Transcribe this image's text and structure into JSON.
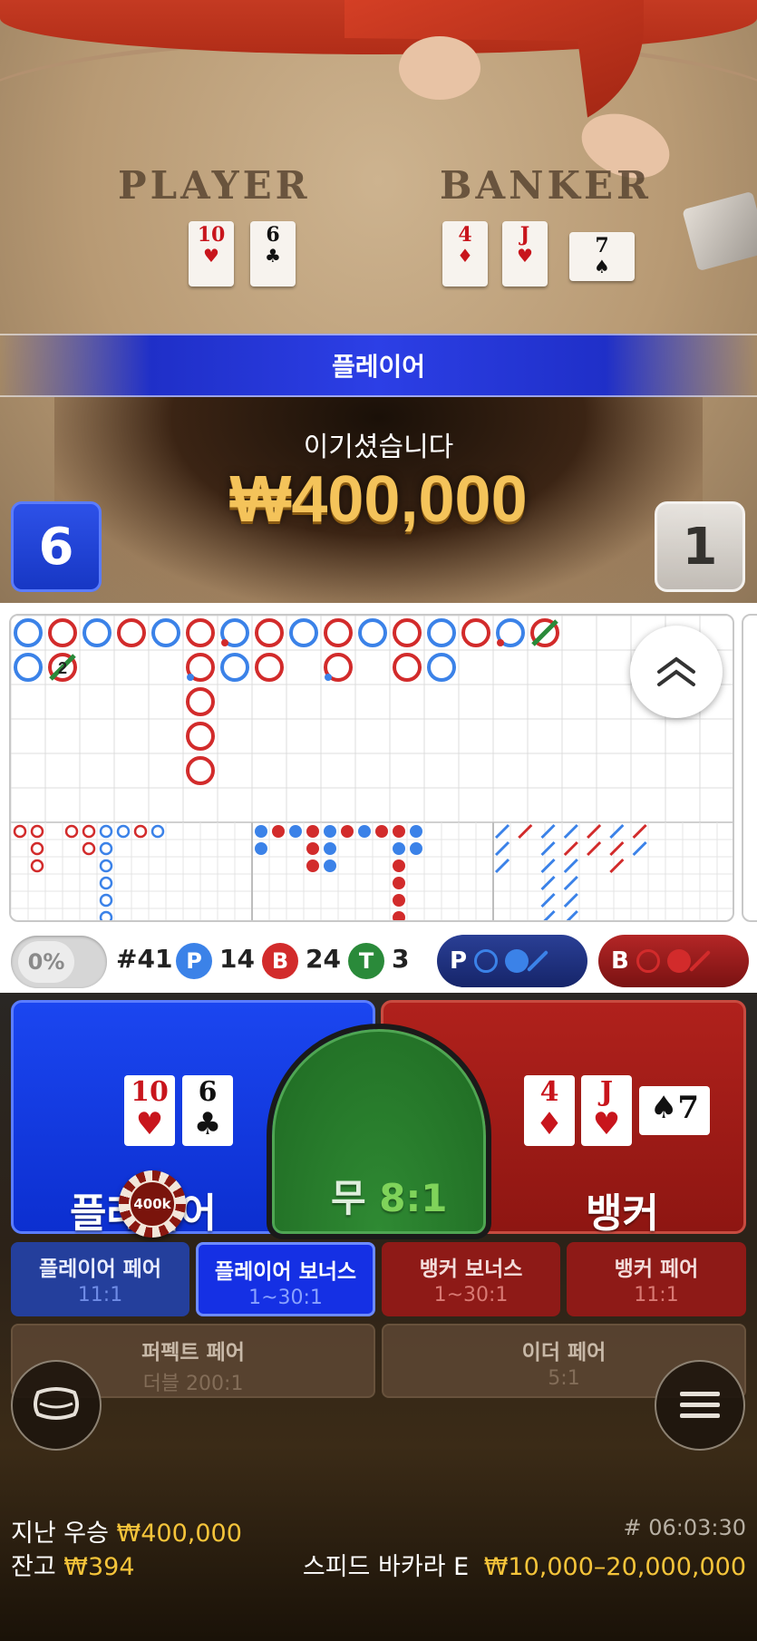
{
  "video": {
    "table_player_label": "PLAYER",
    "table_banker_label": "BANKER",
    "player_cards": [
      {
        "rank": "10",
        "suit": "♥",
        "color": "red"
      },
      {
        "rank": "6",
        "suit": "♣",
        "color": "black"
      }
    ],
    "banker_cards": [
      {
        "rank": "4",
        "suit": "♦",
        "color": "red"
      },
      {
        "rank": "J",
        "suit": "♥",
        "color": "red"
      },
      {
        "rank": "7",
        "suit": "♠",
        "color": "black"
      }
    ],
    "result_banner": "플레이어",
    "win_message": "이기셨습니다",
    "win_amount": "₩400,000",
    "player_score": "6",
    "banker_score": "1"
  },
  "roadmap": {
    "colors": {
      "player": "#3b82e8",
      "banker": "#d22b2b",
      "tie": "#2a8a3a"
    },
    "big_road_columns": [
      [
        "P",
        "P"
      ],
      [
        "B",
        "B2T"
      ],
      [
        "P"
      ],
      [
        "B"
      ],
      [
        "P"
      ],
      [
        "B",
        "Bd",
        "B",
        "B",
        "B"
      ],
      [
        "Pd",
        "P"
      ],
      [
        "B",
        "B"
      ],
      [
        "P"
      ],
      [
        "B",
        "Bd"
      ],
      [
        "P"
      ],
      [
        "B",
        "B"
      ],
      [
        "P",
        "P"
      ],
      [
        "B"
      ],
      [
        "Pd"
      ],
      [
        "BT"
      ]
    ]
  },
  "stats": {
    "percent": "0%",
    "round": "#41",
    "player_letter": "P",
    "player_count": "14",
    "banker_letter": "B",
    "banker_count": "24",
    "tie_letter": "T",
    "tie_count": "3",
    "ask_player": "P",
    "ask_banker": "B"
  },
  "bets": {
    "player": {
      "label": "플레이어",
      "cards": [
        {
          "rank": "10",
          "suit": "♥",
          "color": "red"
        },
        {
          "rank": "6",
          "suit": "♣",
          "color": "black"
        }
      ],
      "chip": "400k"
    },
    "tie": {
      "label": "무",
      "odds": "8:1"
    },
    "banker": {
      "label": "뱅커",
      "cards": [
        {
          "rank": "4",
          "suit": "♦",
          "color": "red"
        },
        {
          "rank": "J",
          "suit": "♥",
          "color": "red"
        },
        {
          "rank": "7",
          "suit": "♠",
          "color": "black"
        }
      ]
    },
    "side": [
      {
        "label": "플레이어 페어",
        "odds": "11:1"
      },
      {
        "label": "플레이어 보너스",
        "odds": "1~30:1"
      },
      {
        "label": "뱅커 보너스",
        "odds": "1~30:1"
      },
      {
        "label": "뱅커 페어",
        "odds": "11:1"
      },
      {
        "label": "퍼펙트 페어",
        "odds": "더블 200:1"
      },
      {
        "label": "이더 페어",
        "odds": "5:1"
      }
    ]
  },
  "footer": {
    "last_win_label": "지난 우승",
    "last_win_amount": "₩400,000",
    "balance_label": "잔고",
    "balance_amount": "₩394",
    "timestamp": "# 06:03:30",
    "table_name": "스피드 바카라 E",
    "limits": "₩10,000–20,000,000"
  },
  "icons": {
    "chat": "chat-bubble-icon",
    "menu": "hamburger-menu-icon",
    "collapse": "double-chevron-up-icon"
  }
}
